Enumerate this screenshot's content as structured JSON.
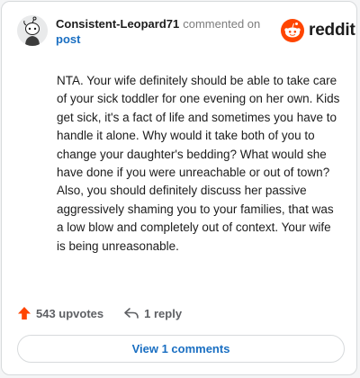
{
  "comment": {
    "username": "Consistent-Leopard71",
    "action_text": "commented on",
    "post_link": "post",
    "body": "NTA. Your wife definitely should be able to take care of your sick toddler for one evening on her own. Kids get sick, it's a fact of life and sometimes you have to handle it alone. Why would it take both of you to change your daughter's bedding? What would she have done if you were unreachable or out of town? Also, you should definitely discuss her passive aggressively shaming you to your families, that was a low blow and completely out of context. Your wife is being unreasonable."
  },
  "brand": {
    "name": "reddit",
    "color": "#ff4500"
  },
  "actions": {
    "upvotes_label": "543 upvotes",
    "reply_label": "1 reply",
    "view_comments_label": "View 1 comments"
  },
  "icons": {
    "avatar": "snoo-avatar-icon",
    "logo": "reddit-logo-icon",
    "upvote": "upvote-arrow-icon",
    "reply": "reply-arrow-icon"
  },
  "colors": {
    "upvote": "#ff4500",
    "link": "#1a6fc2",
    "muted": "#7c7c7c"
  }
}
